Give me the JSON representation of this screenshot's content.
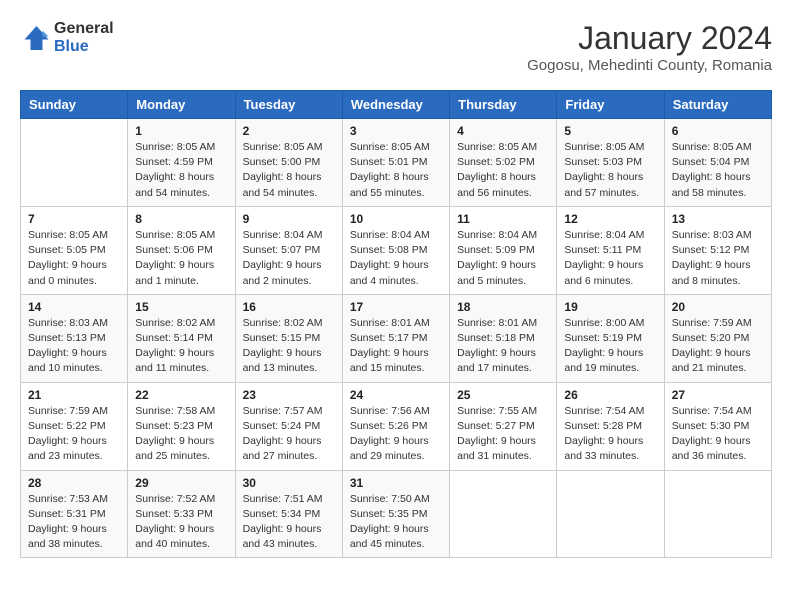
{
  "header": {
    "logo_line1": "General",
    "logo_line2": "Blue",
    "month": "January 2024",
    "location": "Gogosu, Mehedinti County, Romania"
  },
  "days_of_week": [
    "Sunday",
    "Monday",
    "Tuesday",
    "Wednesday",
    "Thursday",
    "Friday",
    "Saturday"
  ],
  "weeks": [
    [
      null,
      {
        "num": "1",
        "sunrise": "8:05 AM",
        "sunset": "4:59 PM",
        "daylight": "8 hours and 54 minutes"
      },
      {
        "num": "2",
        "sunrise": "8:05 AM",
        "sunset": "5:00 PM",
        "daylight": "8 hours and 54 minutes"
      },
      {
        "num": "3",
        "sunrise": "8:05 AM",
        "sunset": "5:01 PM",
        "daylight": "8 hours and 55 minutes"
      },
      {
        "num": "4",
        "sunrise": "8:05 AM",
        "sunset": "5:02 PM",
        "daylight": "8 hours and 56 minutes"
      },
      {
        "num": "5",
        "sunrise": "8:05 AM",
        "sunset": "5:03 PM",
        "daylight": "8 hours and 57 minutes"
      },
      {
        "num": "6",
        "sunrise": "8:05 AM",
        "sunset": "5:04 PM",
        "daylight": "8 hours and 58 minutes"
      }
    ],
    [
      {
        "num": "7",
        "sunrise": "8:05 AM",
        "sunset": "5:05 PM",
        "daylight": "9 hours and 0 minutes"
      },
      {
        "num": "8",
        "sunrise": "8:05 AM",
        "sunset": "5:06 PM",
        "daylight": "9 hours and 1 minute"
      },
      {
        "num": "9",
        "sunrise": "8:04 AM",
        "sunset": "5:07 PM",
        "daylight": "9 hours and 2 minutes"
      },
      {
        "num": "10",
        "sunrise": "8:04 AM",
        "sunset": "5:08 PM",
        "daylight": "9 hours and 4 minutes"
      },
      {
        "num": "11",
        "sunrise": "8:04 AM",
        "sunset": "5:09 PM",
        "daylight": "9 hours and 5 minutes"
      },
      {
        "num": "12",
        "sunrise": "8:04 AM",
        "sunset": "5:11 PM",
        "daylight": "9 hours and 6 minutes"
      },
      {
        "num": "13",
        "sunrise": "8:03 AM",
        "sunset": "5:12 PM",
        "daylight": "9 hours and 8 minutes"
      }
    ],
    [
      {
        "num": "14",
        "sunrise": "8:03 AM",
        "sunset": "5:13 PM",
        "daylight": "9 hours and 10 minutes"
      },
      {
        "num": "15",
        "sunrise": "8:02 AM",
        "sunset": "5:14 PM",
        "daylight": "9 hours and 11 minutes"
      },
      {
        "num": "16",
        "sunrise": "8:02 AM",
        "sunset": "5:15 PM",
        "daylight": "9 hours and 13 minutes"
      },
      {
        "num": "17",
        "sunrise": "8:01 AM",
        "sunset": "5:17 PM",
        "daylight": "9 hours and 15 minutes"
      },
      {
        "num": "18",
        "sunrise": "8:01 AM",
        "sunset": "5:18 PM",
        "daylight": "9 hours and 17 minutes"
      },
      {
        "num": "19",
        "sunrise": "8:00 AM",
        "sunset": "5:19 PM",
        "daylight": "9 hours and 19 minutes"
      },
      {
        "num": "20",
        "sunrise": "7:59 AM",
        "sunset": "5:20 PM",
        "daylight": "9 hours and 21 minutes"
      }
    ],
    [
      {
        "num": "21",
        "sunrise": "7:59 AM",
        "sunset": "5:22 PM",
        "daylight": "9 hours and 23 minutes"
      },
      {
        "num": "22",
        "sunrise": "7:58 AM",
        "sunset": "5:23 PM",
        "daylight": "9 hours and 25 minutes"
      },
      {
        "num": "23",
        "sunrise": "7:57 AM",
        "sunset": "5:24 PM",
        "daylight": "9 hours and 27 minutes"
      },
      {
        "num": "24",
        "sunrise": "7:56 AM",
        "sunset": "5:26 PM",
        "daylight": "9 hours and 29 minutes"
      },
      {
        "num": "25",
        "sunrise": "7:55 AM",
        "sunset": "5:27 PM",
        "daylight": "9 hours and 31 minutes"
      },
      {
        "num": "26",
        "sunrise": "7:54 AM",
        "sunset": "5:28 PM",
        "daylight": "9 hours and 33 minutes"
      },
      {
        "num": "27",
        "sunrise": "7:54 AM",
        "sunset": "5:30 PM",
        "daylight": "9 hours and 36 minutes"
      }
    ],
    [
      {
        "num": "28",
        "sunrise": "7:53 AM",
        "sunset": "5:31 PM",
        "daylight": "9 hours and 38 minutes"
      },
      {
        "num": "29",
        "sunrise": "7:52 AM",
        "sunset": "5:33 PM",
        "daylight": "9 hours and 40 minutes"
      },
      {
        "num": "30",
        "sunrise": "7:51 AM",
        "sunset": "5:34 PM",
        "daylight": "9 hours and 43 minutes"
      },
      {
        "num": "31",
        "sunrise": "7:50 AM",
        "sunset": "5:35 PM",
        "daylight": "9 hours and 45 minutes"
      },
      null,
      null,
      null
    ]
  ]
}
